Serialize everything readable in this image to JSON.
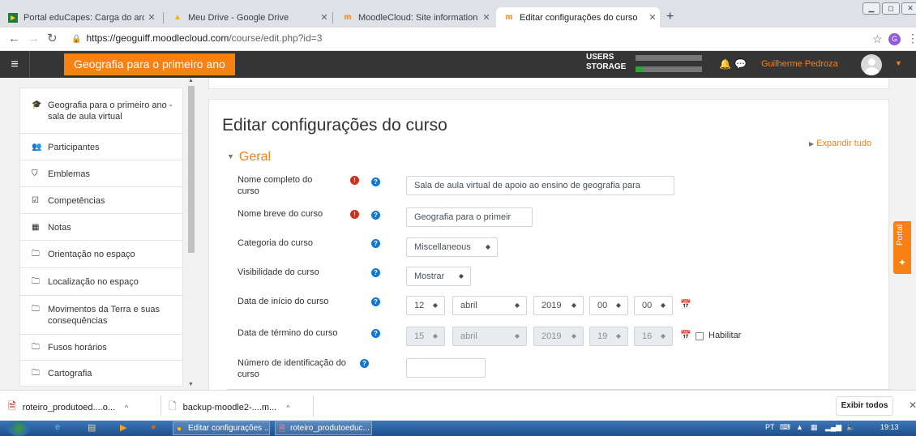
{
  "browser": {
    "tabs": [
      {
        "title": "Portal eduCapes: Carga do arqui",
        "favicon": "capes-flag-icon"
      },
      {
        "title": "Meu Drive - Google Drive",
        "favicon": "google-drive-icon"
      },
      {
        "title": "MoodleCloud: Site information fo",
        "favicon": "moodle-icon"
      },
      {
        "title": "Editar configurações do curso",
        "favicon": "moodle-icon",
        "active": true
      }
    ],
    "new_tab": "+",
    "url_host": "https://geoguiff.moodlecloud.com",
    "url_path": "/course/edit.php?id=3",
    "profile_initial": "G"
  },
  "navbar": {
    "site_name": "Geografia para o primeiro ano",
    "users_label": "USERS",
    "storage_label": "STORAGE",
    "users_fill": 0.0,
    "storage_fill": 0.12,
    "username": "Guilherme Pedroza"
  },
  "sidebar": {
    "items": [
      {
        "icon": "graduation-cap-icon",
        "label": "Geografia para o primeiro ano - sala de aula virtual"
      },
      {
        "icon": "users-icon",
        "label": "Participantes"
      },
      {
        "icon": "shield-icon",
        "label": "Emblemas"
      },
      {
        "icon": "check-square-icon",
        "label": "Competências"
      },
      {
        "icon": "table-icon",
        "label": "Notas"
      },
      {
        "icon": "folder-icon",
        "label": "Orientação no espaço"
      },
      {
        "icon": "folder-icon",
        "label": "Localização no espaço"
      },
      {
        "icon": "folder-icon",
        "label": "Movimentos da Terra e suas consequências"
      },
      {
        "icon": "folder-icon",
        "label": "Fusos horários"
      },
      {
        "icon": "folder-icon",
        "label": "Cartografia"
      }
    ]
  },
  "form": {
    "page_title": "Editar configurações do curso",
    "expand_all": "Expandir tudo",
    "section": "Geral",
    "fullname": {
      "label": "Nome completo do curso",
      "value": "Sala de aula virtual de apoio ao ensino de geografia para"
    },
    "shortname": {
      "label": "Nome breve do curso",
      "value": "Geografia para o primeir"
    },
    "category": {
      "label": "Categoria do curso",
      "value": "Miscellaneous"
    },
    "visibility": {
      "label": "Visibilidade do curso",
      "value": "Mostrar"
    },
    "startdate": {
      "label": "Data de início do curso",
      "day": "12",
      "month": "abril",
      "year": "2019",
      "hour": "00",
      "minute": "00"
    },
    "enddate": {
      "label": "Data de término do curso",
      "day": "15",
      "month": "abril",
      "year": "2019",
      "hour": "19",
      "minute": "16",
      "enable_label": "Habilitar"
    },
    "idnumber": {
      "label": "Número de identificação do curso",
      "value": ""
    }
  },
  "portal_tab": "Portal",
  "downloads": {
    "items": [
      {
        "name": "roteiro_produtoed....o...",
        "icon": "pdf-file-icon"
      },
      {
        "name": "backup-moodle2-....m...",
        "icon": "file-icon"
      }
    ],
    "show_all": "Exibir todos"
  },
  "taskbar": {
    "buttons": [
      "Editar configurações ...",
      "roteiro_produtoeduc..."
    ],
    "language": "PT",
    "time": "19:13"
  }
}
